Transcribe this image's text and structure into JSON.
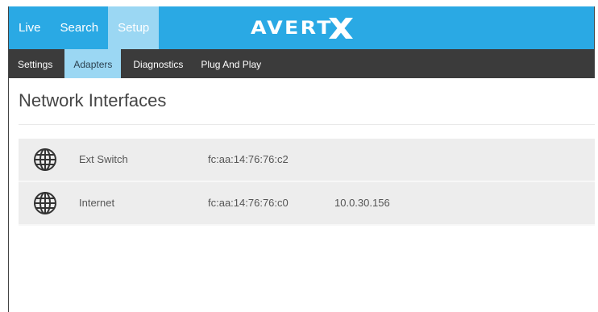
{
  "topnav": {
    "items": [
      {
        "label": "Live"
      },
      {
        "label": "Search"
      },
      {
        "label": "Setup"
      }
    ],
    "active": "Setup"
  },
  "brand": {
    "logo_text": "AVERT",
    "logo_mark": "X"
  },
  "subnav": {
    "items": [
      {
        "label": "Settings"
      },
      {
        "label": "Adapters"
      },
      {
        "label": "Diagnostics"
      },
      {
        "label": "Plug And Play"
      }
    ],
    "active": "Adapters"
  },
  "page": {
    "title": "Network Interfaces"
  },
  "interfaces": [
    {
      "icon": "globe-icon",
      "name": "Ext Switch",
      "mac": "fc:aa:14:76:76:c2",
      "ip": ""
    },
    {
      "icon": "globe-icon",
      "name": "Internet",
      "mac": "fc:aa:14:76:76:c0",
      "ip": "10.0.30.156"
    }
  ],
  "colors": {
    "topbar": "#2aa9e4",
    "active_tab": "#9bd7f3",
    "subbar": "#3b3b3b",
    "row_bg": "#ededed"
  }
}
